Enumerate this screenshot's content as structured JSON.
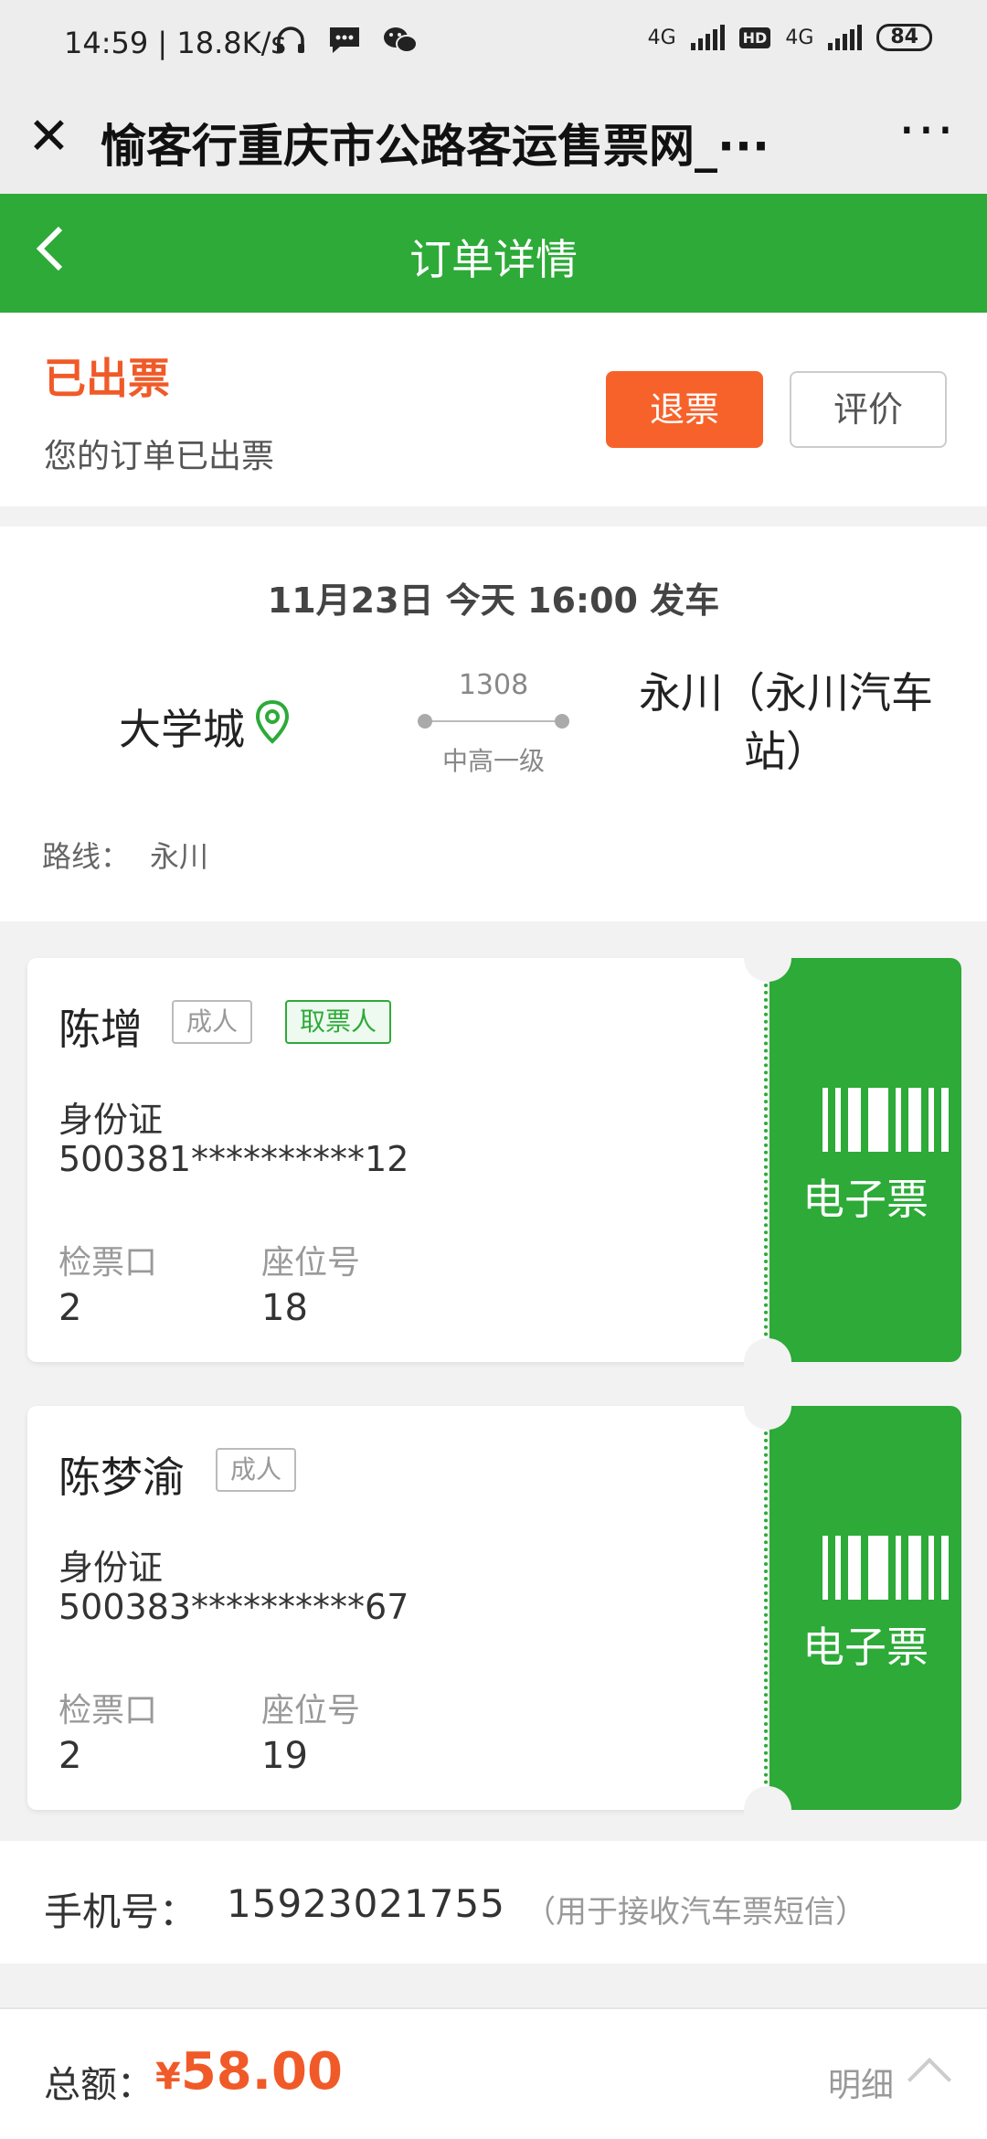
{
  "status_bar": {
    "time": "14:59 | 18.8K/s",
    "network_1": "4G",
    "hd": "HD",
    "network_2": "4G",
    "battery": "84"
  },
  "title_bar": {
    "title": "愉客行重庆市公路客运售票网_···"
  },
  "header": {
    "title": "订单详情"
  },
  "order_status": {
    "title": "已出票",
    "subtitle": "您的订单已出票",
    "refund_label": "退票",
    "review_label": "评价"
  },
  "trip": {
    "departure": "11月23日 今天 16:00 发车",
    "from": "大学城",
    "bus_code": "1308",
    "bus_grade": "中高一级",
    "to": "永川（永川汽车站）",
    "route_label": "路线：",
    "route_value": "永川"
  },
  "tickets": [
    {
      "name": "陈增",
      "tag_type": "成人",
      "tag_pickup": "取票人",
      "id_type": "身份证",
      "id_number": "500381**********12",
      "gate_label": "检票口",
      "gate": "2",
      "seat_label": "座位号",
      "seat": "18",
      "eticket": "电子票"
    },
    {
      "name": "陈梦渝",
      "tag_type": "成人",
      "id_type": "身份证",
      "id_number": "500383**********67",
      "gate_label": "检票口",
      "gate": "2",
      "seat_label": "座位号",
      "seat": "19",
      "eticket": "电子票"
    }
  ],
  "contact": {
    "label": "手机号：",
    "phone": "15923021755",
    "note": "（用于接收汽车票短信）"
  },
  "footer": {
    "total_label": "总额：",
    "currency": "¥",
    "amount": "58.00",
    "detail_label": "明细"
  },
  "colors": {
    "brand_green": "#2daa38",
    "accent_orange": "#f05a28"
  }
}
